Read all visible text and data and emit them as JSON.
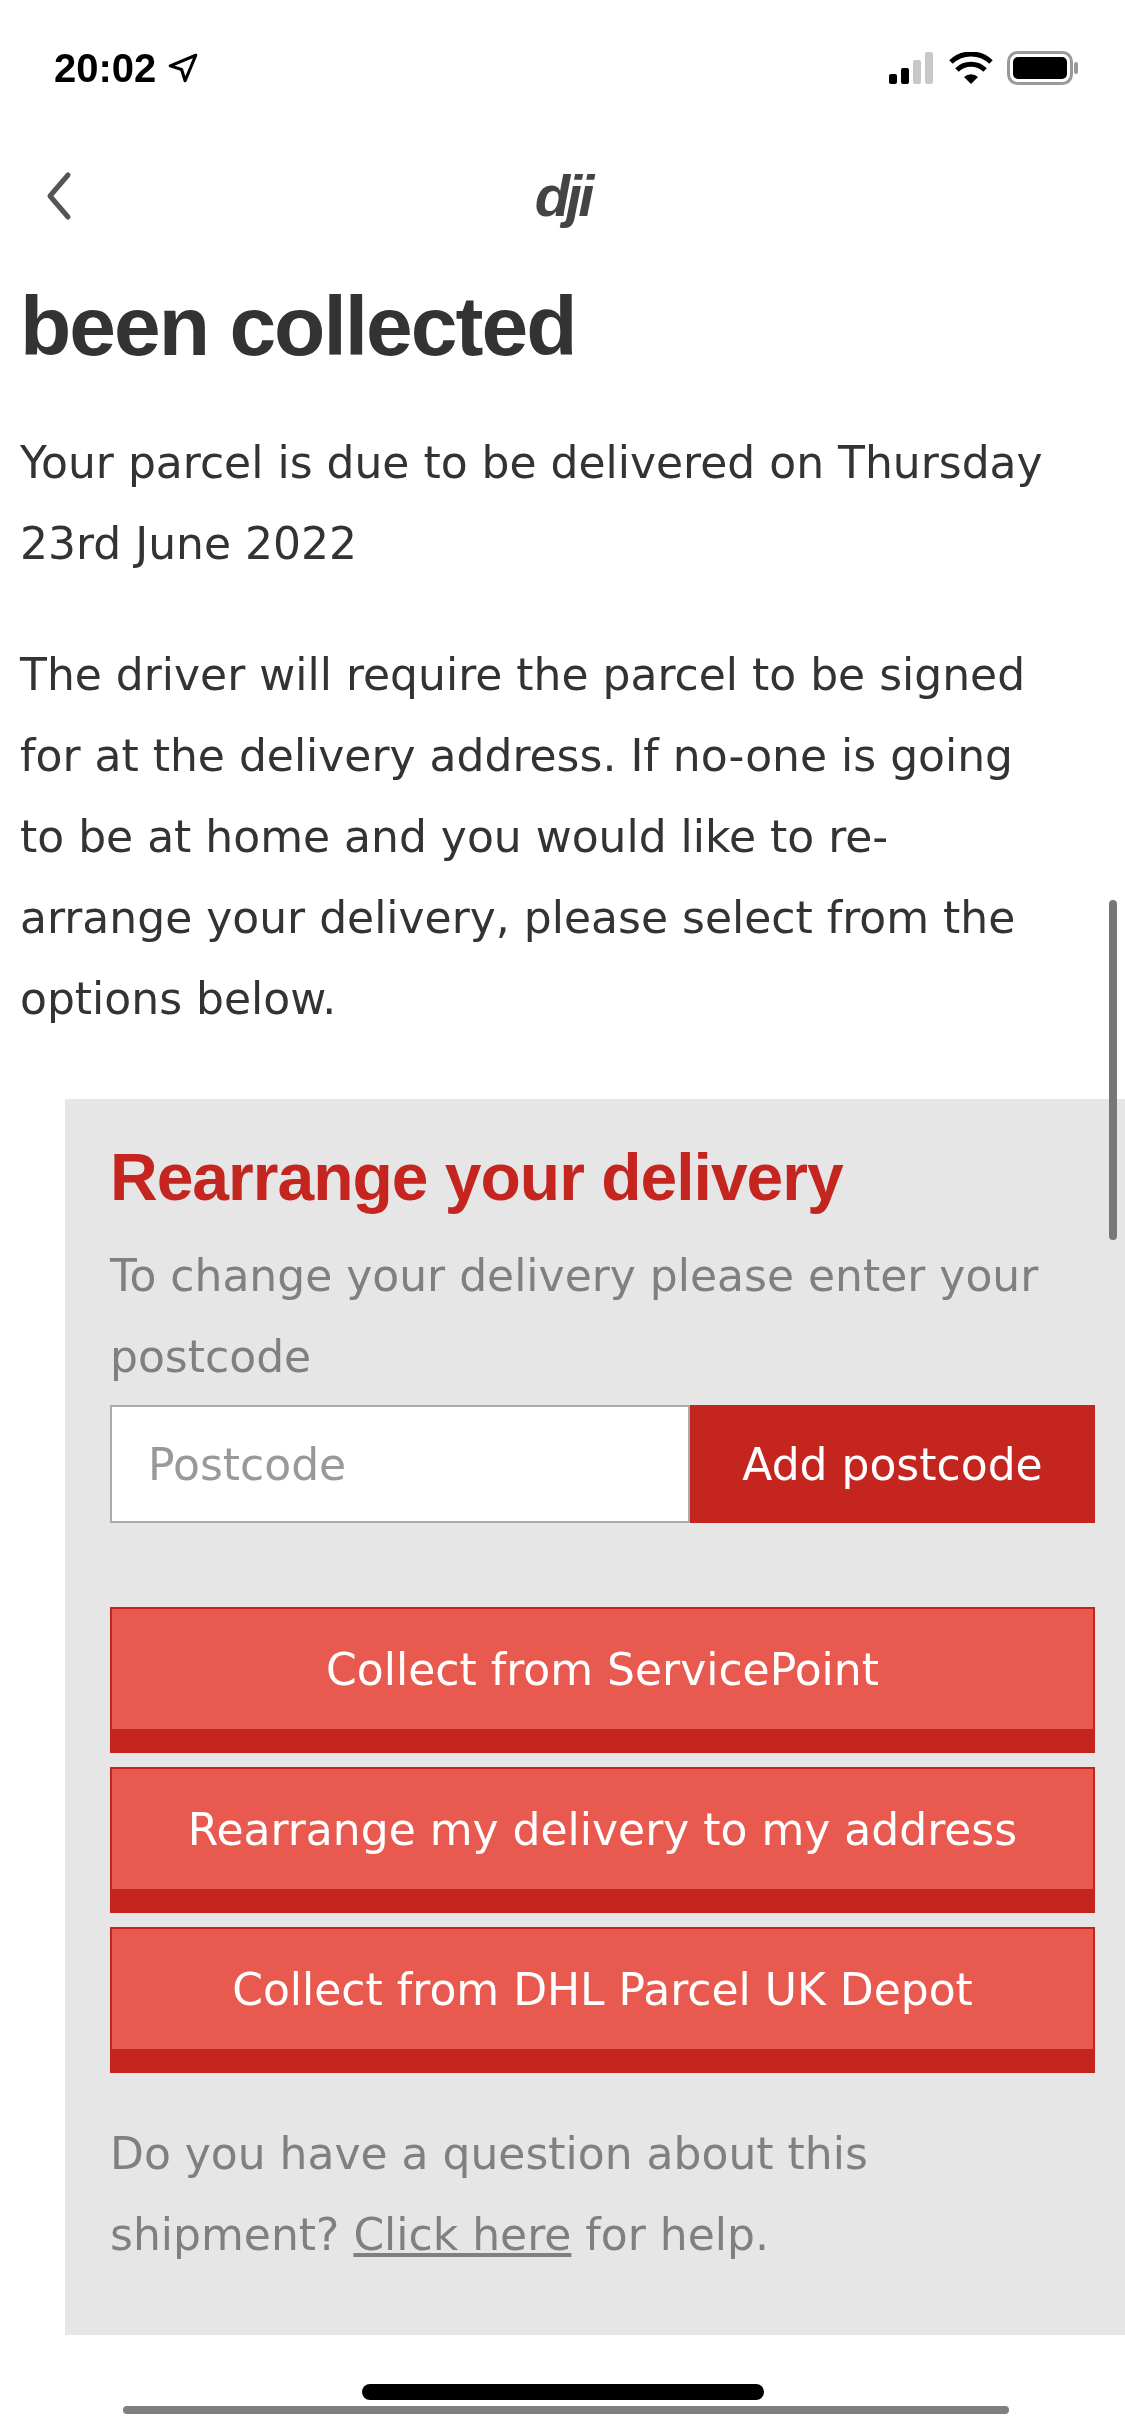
{
  "status_bar": {
    "time": "20:02"
  },
  "nav": {
    "logo": "dji"
  },
  "heading": "been collected",
  "paragraphs": [
    "Your parcel is due to be delivered on Thursday 23rd June 2022",
    "The driver will require the parcel to be signed for at the delivery address. If no-one is going to be at home and you would like to re-arrange your delivery, please select from the options below."
  ],
  "panel": {
    "title": "Rearrange your delivery",
    "intro": "To change your delivery please enter your postcode",
    "postcode": {
      "placeholder": "Postcode",
      "button": "Add postcode"
    },
    "options": [
      "Collect from ServicePoint",
      "Rearrange my delivery to my address",
      "Collect from DHL Parcel UK Depot"
    ],
    "help": {
      "before": "Do you have a question about this shipment?",
      "link": "Click here",
      "after": "for help."
    }
  }
}
